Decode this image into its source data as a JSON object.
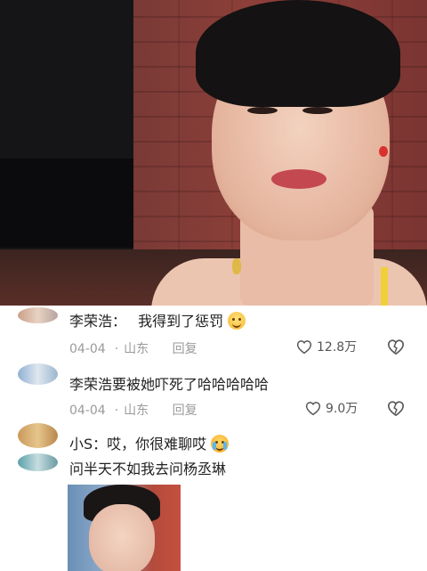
{
  "comments": [
    {
      "username": "李荣浩：",
      "text": "我得到了惩罚",
      "date": "04-04",
      "location": "山东",
      "reply_label": "回复",
      "likes": "12.8万",
      "emoji": "smile-emoji"
    },
    {
      "text": "李荣浩要被她吓死了哈哈哈哈哈",
      "date": "04-04",
      "location": "山东",
      "reply_label": "回复",
      "likes": "9.0万"
    },
    {
      "line1": "小S：哎，你很难聊哎",
      "line2": "问半天不如我去问杨丞琳",
      "emoji": "cry-laugh-emoji"
    }
  ],
  "meta_separator": "·",
  "colors": {
    "text": "#222222",
    "meta": "#9a9a9a",
    "background": "#ffffff"
  }
}
